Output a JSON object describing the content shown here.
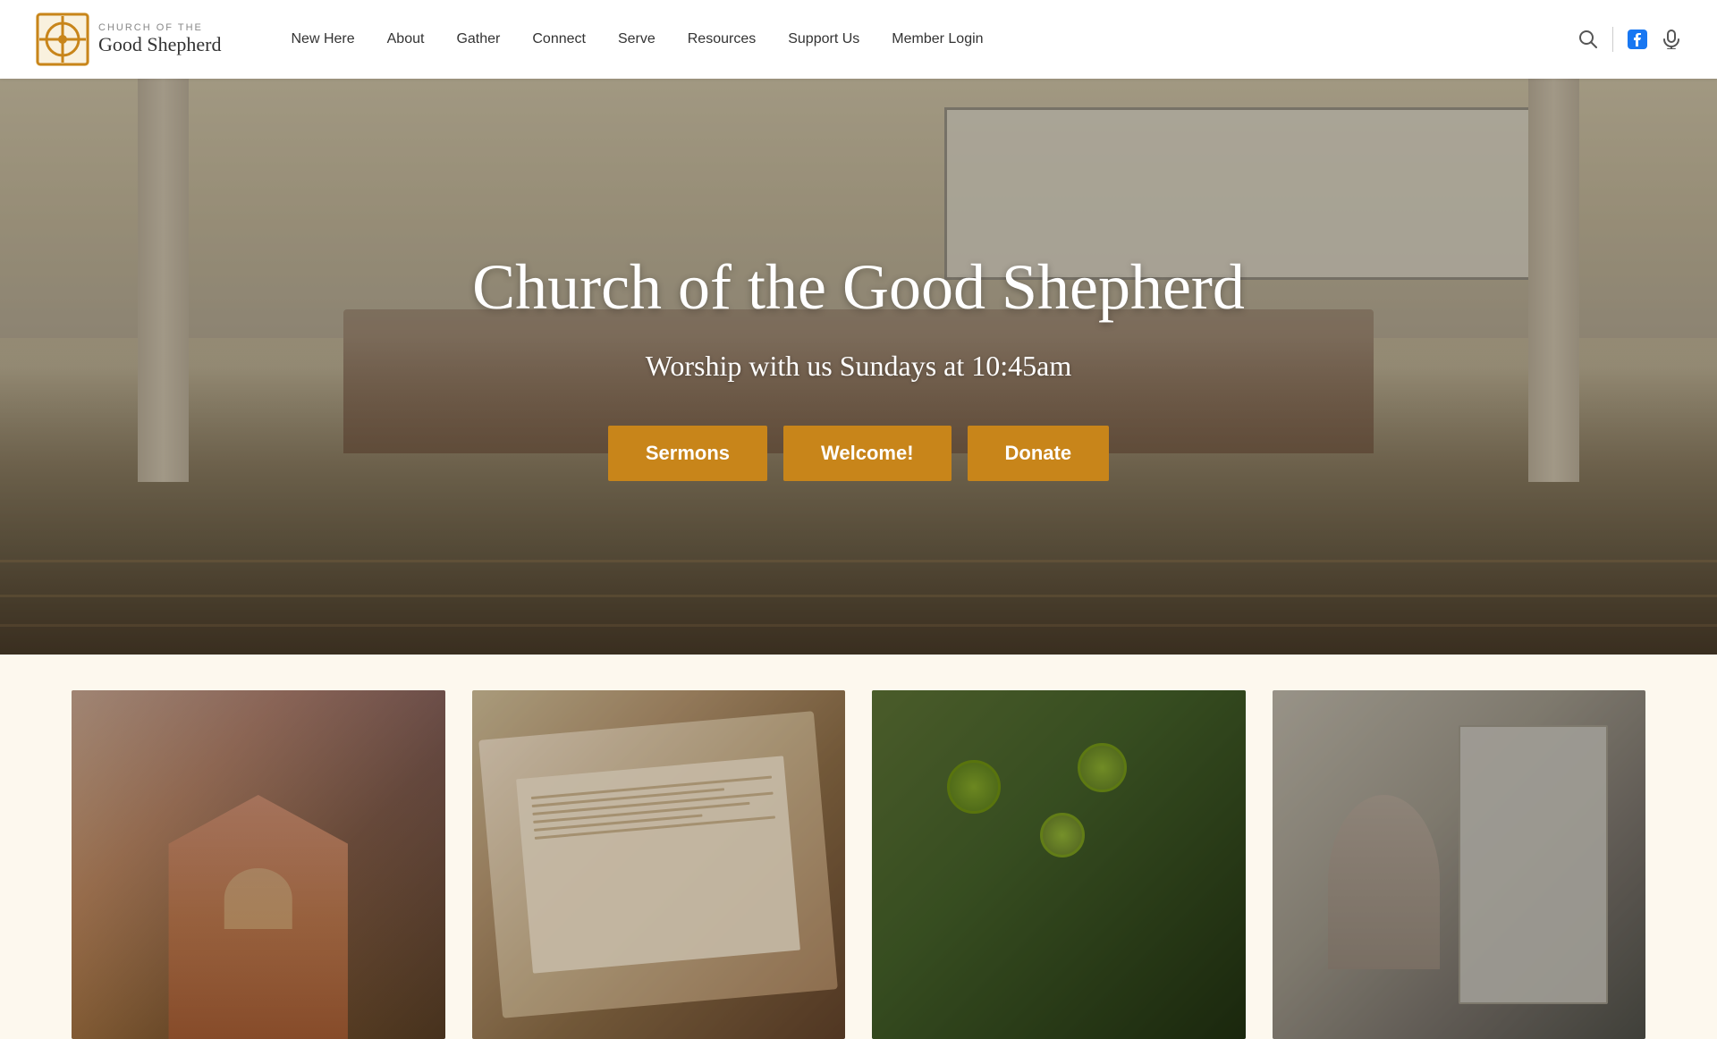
{
  "header": {
    "logo": {
      "subtitle": "CHURCH OF THE",
      "title": "Good Shepherd"
    },
    "nav": [
      {
        "label": "New Here",
        "id": "nav-new-here"
      },
      {
        "label": "About",
        "id": "nav-about"
      },
      {
        "label": "Gather",
        "id": "nav-gather"
      },
      {
        "label": "Connect",
        "id": "nav-connect"
      },
      {
        "label": "Serve",
        "id": "nav-serve"
      },
      {
        "label": "Resources",
        "id": "nav-resources"
      },
      {
        "label": "Support Us",
        "id": "nav-support-us"
      },
      {
        "label": "Member Login",
        "id": "nav-member-login"
      }
    ]
  },
  "hero": {
    "title": "Church of the Good Shepherd",
    "subtitle": "Worship with us Sundays at 10:45am",
    "buttons": [
      {
        "label": "Sermons",
        "id": "btn-sermons"
      },
      {
        "label": "Welcome!",
        "id": "btn-welcome"
      },
      {
        "label": "Donate",
        "id": "btn-donate"
      }
    ]
  },
  "icons": {
    "search": "🔍",
    "facebook": "f",
    "microphone": "🎙"
  }
}
